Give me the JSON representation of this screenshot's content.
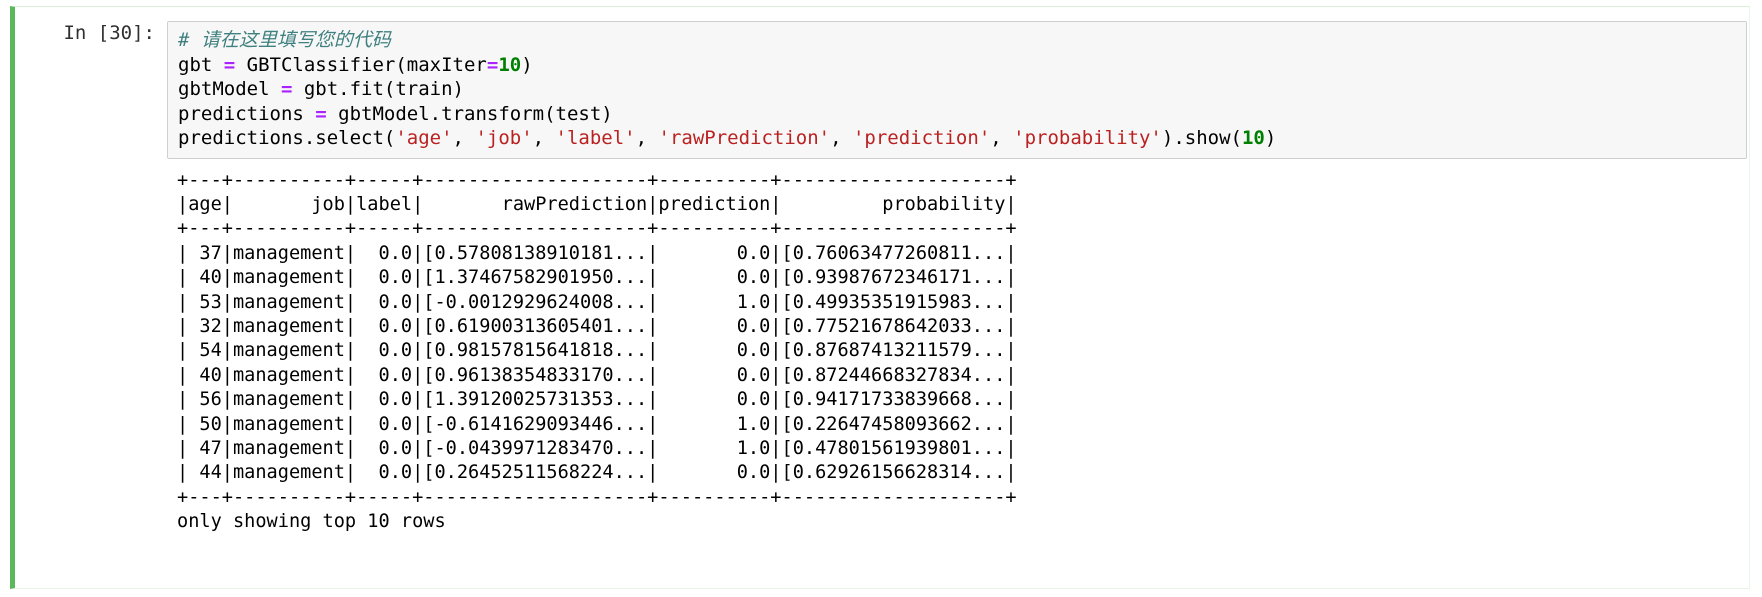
{
  "cell": {
    "prompt_label": "In [30]:",
    "execution_count": 30,
    "accent_color": "#5cb85c",
    "input_background": "#f7f7f7"
  },
  "code": {
    "lines": [
      [
        {
          "t": "comment",
          "s": "# 请在这里填写您的代码"
        }
      ],
      [
        {
          "t": "plain",
          "s": "gbt "
        },
        {
          "t": "op",
          "s": "="
        },
        {
          "t": "plain",
          "s": " GBTClassifier(maxIter"
        },
        {
          "t": "op",
          "s": "="
        },
        {
          "t": "num",
          "s": "10"
        },
        {
          "t": "plain",
          "s": ")"
        }
      ],
      [
        {
          "t": "plain",
          "s": "gbtModel "
        },
        {
          "t": "op",
          "s": "="
        },
        {
          "t": "plain",
          "s": " gbt.fit(train)"
        }
      ],
      [
        {
          "t": "plain",
          "s": "predictions "
        },
        {
          "t": "op",
          "s": "="
        },
        {
          "t": "plain",
          "s": " gbtModel.transform(test)"
        }
      ],
      [
        {
          "t": "plain",
          "s": "predictions.select("
        },
        {
          "t": "str",
          "s": "'age'"
        },
        {
          "t": "plain",
          "s": ", "
        },
        {
          "t": "str",
          "s": "'job'"
        },
        {
          "t": "plain",
          "s": ", "
        },
        {
          "t": "str",
          "s": "'label'"
        },
        {
          "t": "plain",
          "s": ", "
        },
        {
          "t": "str",
          "s": "'rawPrediction'"
        },
        {
          "t": "plain",
          "s": ", "
        },
        {
          "t": "str",
          "s": "'prediction'"
        },
        {
          "t": "plain",
          "s": ", "
        },
        {
          "t": "str",
          "s": "'probability'"
        },
        {
          "t": "plain",
          "s": ").show("
        },
        {
          "t": "num",
          "s": "10"
        },
        {
          "t": "plain",
          "s": ")"
        }
      ]
    ]
  },
  "output": {
    "columns": [
      "age",
      "job",
      "label",
      "rawPrediction",
      "prediction",
      "probability"
    ],
    "rows": [
      {
        "age": "37",
        "job": "management",
        "label": "0.0",
        "rawPrediction": "[0.57808138910181...",
        "prediction": "0.0",
        "probability": "[0.76063477260811..."
      },
      {
        "age": "40",
        "job": "management",
        "label": "0.0",
        "rawPrediction": "[1.37467582901950...",
        "prediction": "0.0",
        "probability": "[0.93987672346171..."
      },
      {
        "age": "53",
        "job": "management",
        "label": "0.0",
        "rawPrediction": "[-0.0012929624008...",
        "prediction": "1.0",
        "probability": "[0.49935351915983..."
      },
      {
        "age": "32",
        "job": "management",
        "label": "0.0",
        "rawPrediction": "[0.61900313605401...",
        "prediction": "0.0",
        "probability": "[0.77521678642033..."
      },
      {
        "age": "54",
        "job": "management",
        "label": "0.0",
        "rawPrediction": "[0.98157815641818...",
        "prediction": "0.0",
        "probability": "[0.87687413211579..."
      },
      {
        "age": "40",
        "job": "management",
        "label": "0.0",
        "rawPrediction": "[0.96138354833170...",
        "prediction": "0.0",
        "probability": "[0.87244668327834..."
      },
      {
        "age": "56",
        "job": "management",
        "label": "0.0",
        "rawPrediction": "[1.39120025731353...",
        "prediction": "0.0",
        "probability": "[0.94171733839668..."
      },
      {
        "age": "50",
        "job": "management",
        "label": "0.0",
        "rawPrediction": "[-0.6141629093446...",
        "prediction": "1.0",
        "probability": "[0.22647458093662..."
      },
      {
        "age": "47",
        "job": "management",
        "label": "0.0",
        "rawPrediction": "[-0.0439971283470...",
        "prediction": "1.0",
        "probability": "[0.47801561939801..."
      },
      {
        "age": "44",
        "job": "management",
        "label": "0.0",
        "rawPrediction": "[0.26452511568224...",
        "prediction": "0.0",
        "probability": "[0.62926156628314..."
      }
    ],
    "lines": [
      "+---+----------+-----+--------------------+----------+--------------------+",
      "|age|       job|label|       rawPrediction|prediction|         probability|",
      "+---+----------+-----+--------------------+----------+--------------------+",
      "| 37|management|  0.0|[0.57808138910181...|       0.0|[0.76063477260811...|",
      "| 40|management|  0.0|[1.37467582901950...|       0.0|[0.93987672346171...|",
      "| 53|management|  0.0|[-0.0012929624008...|       1.0|[0.49935351915983...|",
      "| 32|management|  0.0|[0.61900313605401...|       0.0|[0.77521678642033...|",
      "| 54|management|  0.0|[0.98157815641818...|       0.0|[0.87687413211579...|",
      "| 40|management|  0.0|[0.96138354833170...|       0.0|[0.87244668327834...|",
      "| 56|management|  0.0|[1.39120025731353...|       0.0|[0.94171733839668...|",
      "| 50|management|  0.0|[-0.6141629093446...|       1.0|[0.22647458093662...|",
      "| 47|management|  0.0|[-0.0439971283470...|       1.0|[0.47801561939801...|",
      "| 44|management|  0.0|[0.26452511568224...|       0.0|[0.62926156628314...|",
      "+---+----------+-----+--------------------+----------+--------------------+",
      "only showing top 10 rows"
    ],
    "footer": "only showing top 10 rows"
  }
}
